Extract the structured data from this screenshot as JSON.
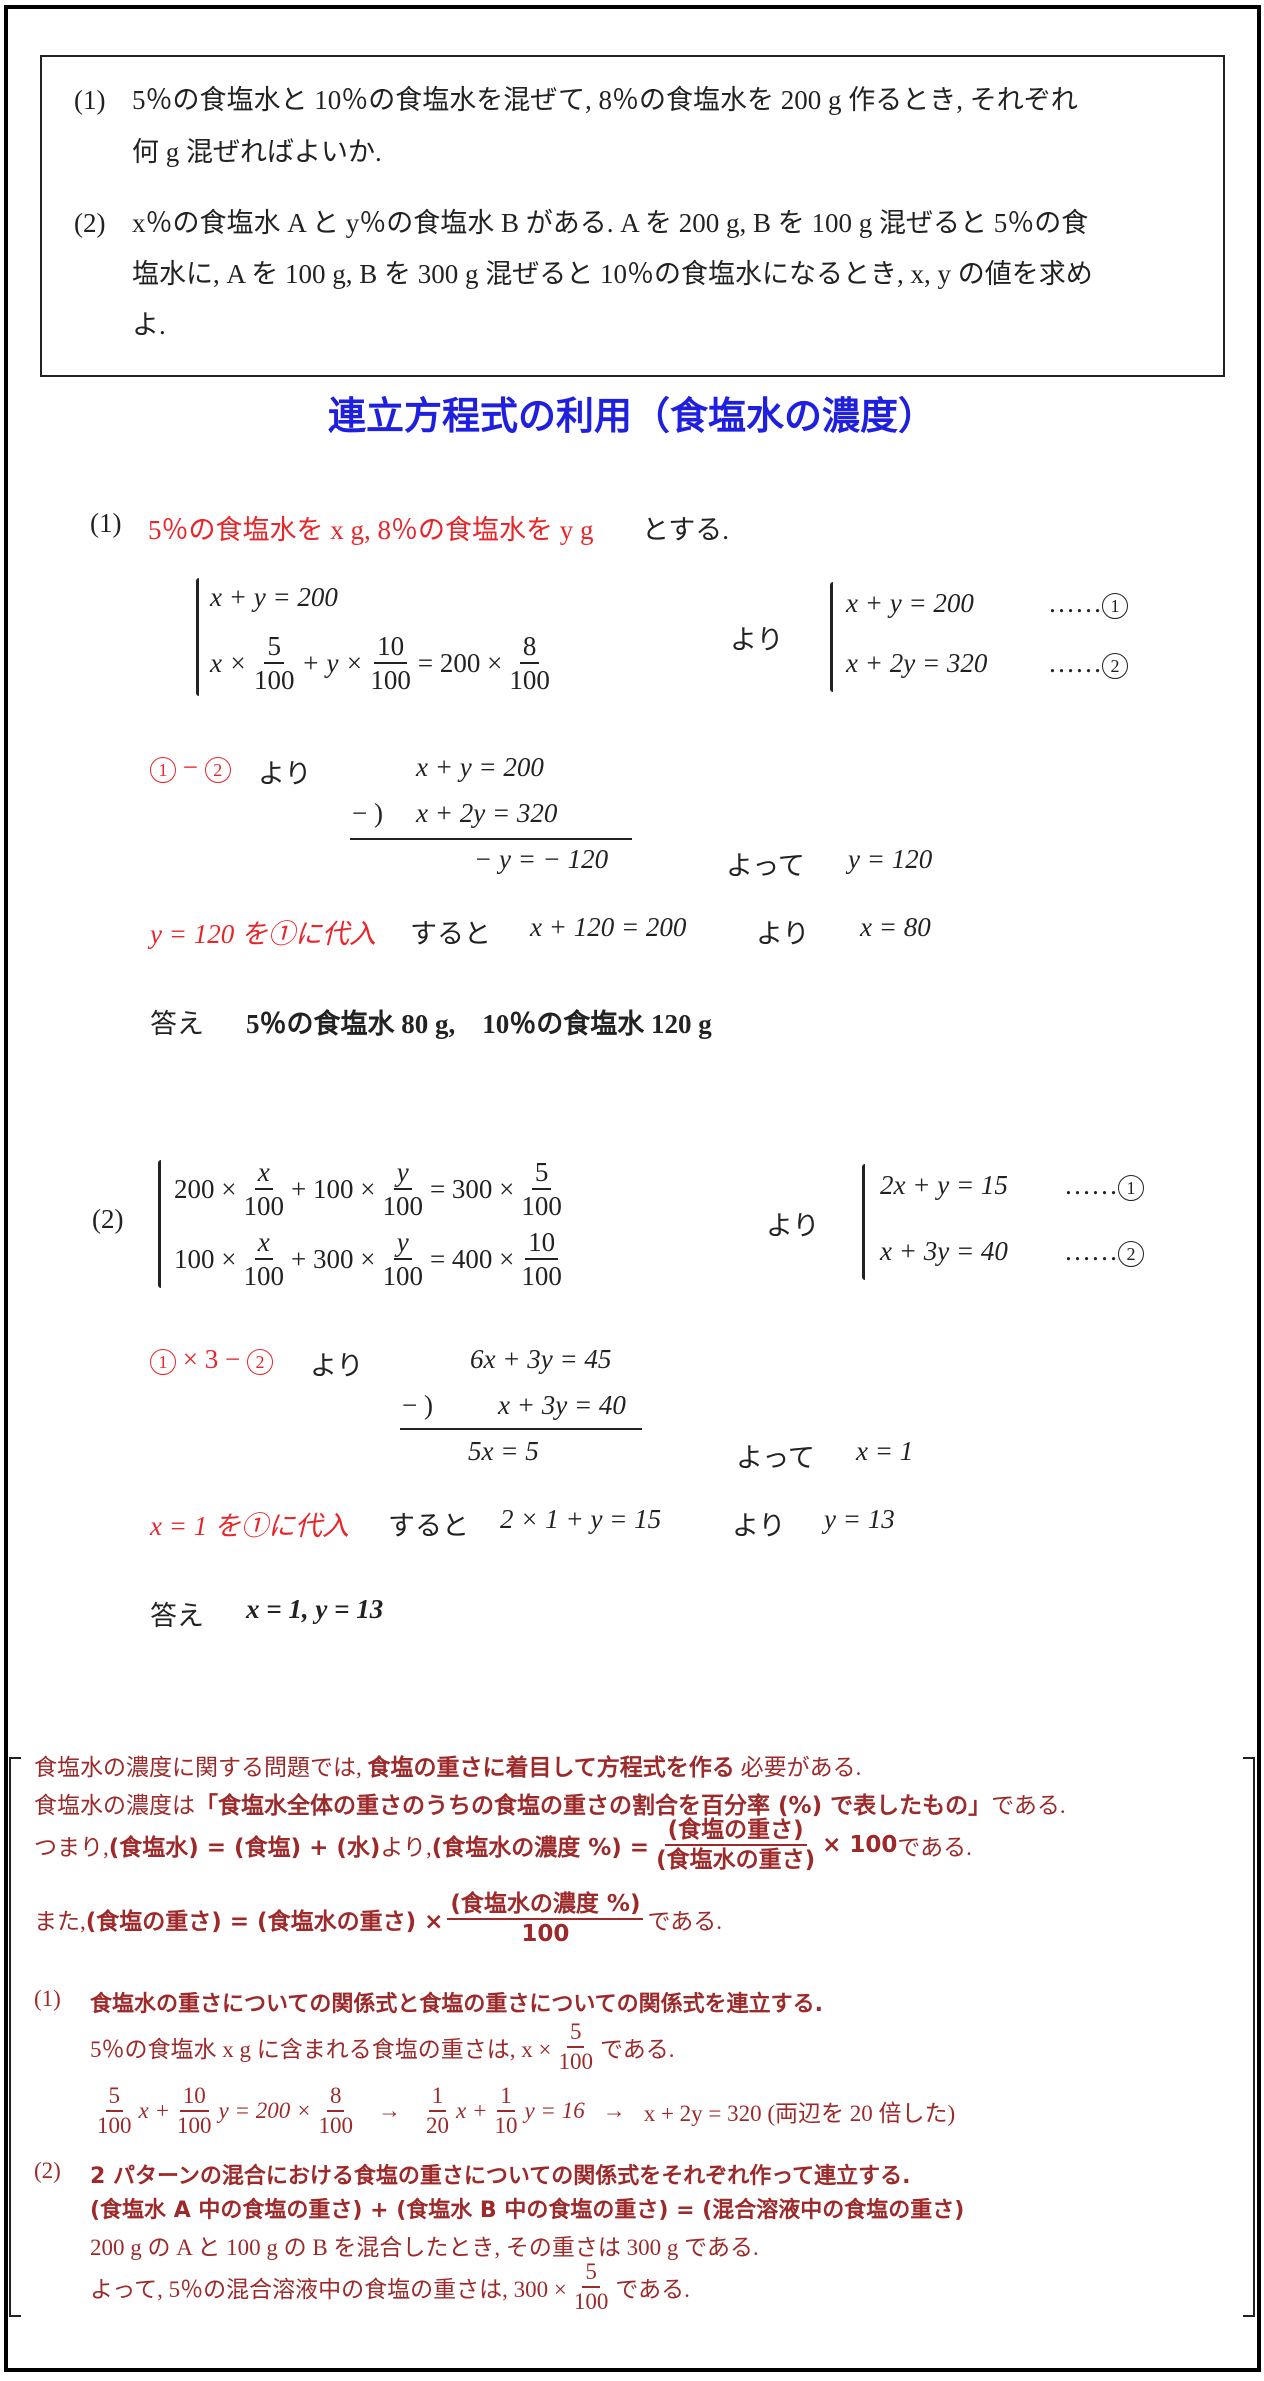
{
  "problems": {
    "p1_label": "(1)",
    "p1_line1": "5％の食塩水と 10％の食塩水を混ぜて, 8％の食塩水を 200 g 作るとき, それぞれ",
    "p1_line2": "何 g 混ぜればよいか.",
    "p2_label": "(2)",
    "p2_line1": "x％の食塩水 A と y％の食塩水 B がある. A を 200 g, B を 100 g 混ぜると 5％の食",
    "p2_line2": "塩水に, A を 100 g, B を 300 g 混ぜると 10％の食塩水になるとき, x, y の値を求め",
    "p2_line3": "よ."
  },
  "title": "連立方程式の利用（食塩水の濃度）",
  "solution1": {
    "label": "(1)",
    "setup_red": "5％の食塩水を x g, 8％の食塩水を y g",
    "setup_black": "とする.",
    "sys_left_1": "x + y = 200",
    "sys_left_2_a": "x ×",
    "sys_left_2_f1n": "5",
    "sys_left_2_f1d": "100",
    "sys_left_2_b": "+ y ×",
    "sys_left_2_f2n": "10",
    "sys_left_2_f2d": "100",
    "sys_left_2_c": "= 200 ×",
    "sys_left_2_f3n": "8",
    "sys_left_2_f3d": "100",
    "yori": "より",
    "sys_right_1": "x + y = 200",
    "sys_right_2": "x + 2y = 320",
    "dots": "……",
    "c1": "1",
    "c2": "2",
    "step_red": "1 − 2",
    "step_yori": "より",
    "elim_1": "x +   y = 200",
    "elim_minus": "− )",
    "elim_2": "x +  2y = 320",
    "elim_result": "− y = − 120",
    "yotte": "よって",
    "y_value": "y = 120",
    "subst_red": "y = 120 を①に代入",
    "subst_black": "すると",
    "subst_eq": "x + 120 = 200",
    "subst_yori": "より",
    "x_value": "x = 80",
    "answer_label": "答え",
    "answer": "5％の食塩水 80 g,　10％の食塩水 120 g"
  },
  "solution2": {
    "label": "(2)",
    "l1_a": "200 ×",
    "l1_f1n": "x",
    "l1_f1d": "100",
    "l1_b": "+ 100 ×",
    "l1_f2n": "y",
    "l1_f2d": "100",
    "l1_c": "= 300 ×",
    "l1_f3n": "5",
    "l1_f3d": "100",
    "l2_a": "100 ×",
    "l2_f1n": "x",
    "l2_f1d": "100",
    "l2_b": "+ 300 ×",
    "l2_f2n": "y",
    "l2_f2d": "100",
    "l2_c": "= 400 ×",
    "l2_f3n": "10",
    "l2_f3d": "100",
    "yori": "より",
    "sys_right_1": "2x + y = 15",
    "sys_right_2": "x + 3y = 40",
    "dots": "……",
    "c1": "1",
    "c2": "2",
    "step_red": "1 × 3 − 2",
    "step_yori": "より",
    "elim_1": "6x + 3y = 45",
    "elim_minus": "− )",
    "elim_2": "x + 3y = 40",
    "elim_result": "5x       = 5",
    "yotte": "よって",
    "x_value": "x = 1",
    "subst_red": "x = 1 を①に代入",
    "subst_black": "すると",
    "subst_eq": "2 × 1 + y = 15",
    "subst_yori": "より",
    "y_value": "y = 13",
    "answer_label": "答え",
    "answer": "x = 1,  y = 13"
  },
  "notes": {
    "line1_a": "食塩水の濃度に関する問題では, ",
    "line1_b": "食塩の重さに着目して方程式を作る",
    "line1_c": " 必要がある.",
    "line2_a": "食塩水の濃度は",
    "line2_b": "「食塩水全体の重さのうちの食塩の重さの割合を百分率 (%) で表したもの」",
    "line2_c": "である.",
    "line3_a": "つまり, ",
    "line3_b": "(食塩水) = (食塩) + (水)",
    "line3_c": " より, ",
    "line3_d": "(食塩水の濃度 %) =",
    "line3_fn": "(食塩の重さ)",
    "line3_fd": "(食塩水の重さ)",
    "line3_e": "× 100",
    "line3_f": " である.",
    "line4_a": "また, ",
    "line4_b": "(食塩の重さ) = (食塩水の重さ) ×",
    "line4_fn": "(食塩水の濃度 %)",
    "line4_fd": "100",
    "line4_c": " である.",
    "n1_label": "(1)",
    "n1_head": "食塩水の重さについての関係式と食塩の重さについての関係式を連立する.",
    "n1_l2_a": "5％の食塩水 x g に含まれる食塩の重さは, x ×",
    "n1_l2_fn": "5",
    "n1_l2_fd": "100",
    "n1_l2_b": " である.",
    "n1_l3_f1n": "5",
    "n1_l3_f1d": "100",
    "n1_l3_a": "x +",
    "n1_l3_f2n": "10",
    "n1_l3_f2d": "100",
    "n1_l3_b": "y = 200 ×",
    "n1_l3_f3n": "8",
    "n1_l3_f3d": "100",
    "arrow": "→",
    "n1_l3_f4n": "1",
    "n1_l3_f4d": "20",
    "n1_l3_c": "x +",
    "n1_l3_f5n": "1",
    "n1_l3_f5d": "10",
    "n1_l3_d": "y = 16",
    "n1_l3_e": "x + 2y = 320 (両辺を 20 倍した)",
    "n2_label": "(2)",
    "n2_head": "2 パターンの混合における食塩の重さについての関係式をそれぞれ作って連立する.",
    "n2_l2": "(食塩水 A 中の食塩の重さ) + (食塩水 B 中の食塩の重さ) = (混合溶液中の食塩の重さ)",
    "n2_l3": "200 g の A と 100 g の B を混合したとき, その重さは 300 g である.",
    "n2_l4_a": "よって, 5％の混合溶液中の食塩の重さは, 300 ×",
    "n2_l4_fn": "5",
    "n2_l4_fd": "100",
    "n2_l4_b": " である."
  },
  "colors": {
    "title": "#1f1fe0",
    "highlight": "#e8262a",
    "notes": "#9c2a2a",
    "text": "#222222"
  }
}
